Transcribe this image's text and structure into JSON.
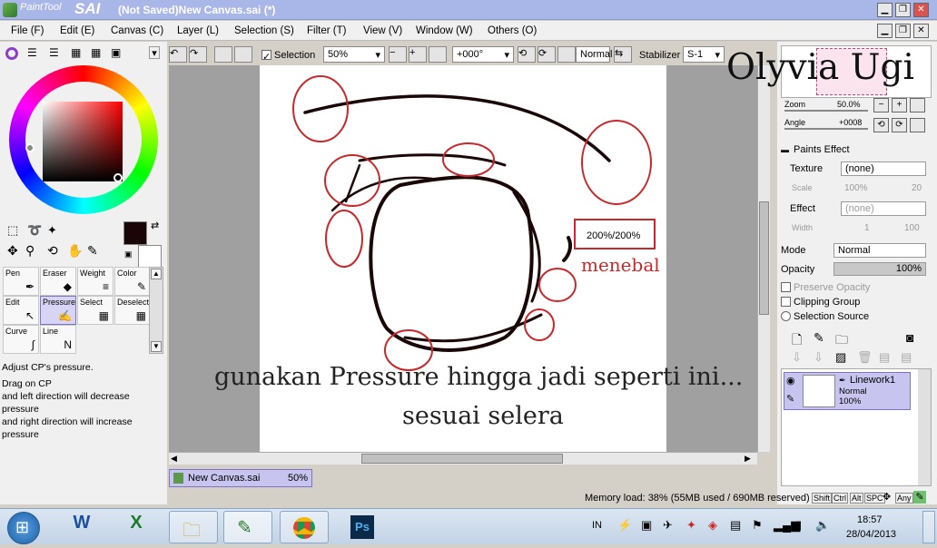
{
  "window": {
    "app": "PaintTool",
    "app_sub": "SAI",
    "title": "(Not Saved)New Canvas.sai (*)"
  },
  "menu": [
    "File (F)",
    "Edit (E)",
    "Canvas (C)",
    "Layer (L)",
    "Selection (S)",
    "Filter (T)",
    "View (V)",
    "Window (W)",
    "Others (O)"
  ],
  "toolbar": {
    "selection_label": "Selection",
    "zoom": "50%",
    "angle": "+000°",
    "blend": "Normal",
    "stabilizer_label": "Stabilizer",
    "stabilizer_value": "S-1"
  },
  "tools": [
    {
      "name": "Pen"
    },
    {
      "name": "Eraser"
    },
    {
      "name": "Weight"
    },
    {
      "name": "Color"
    },
    {
      "name": "Edit"
    },
    {
      "name": "Pressure"
    },
    {
      "name": "Select"
    },
    {
      "name": "Deselect"
    },
    {
      "name": "Curve"
    },
    {
      "name": "Line"
    }
  ],
  "help": {
    "title": "Adjust CP's pressure.",
    "lines": [
      "Drag on CP",
      "and left direction will decrease pressure",
      "and right direction will increase pressure"
    ]
  },
  "navigator": {
    "zoom_label": "Zoom",
    "zoom_value": "50.0%",
    "angle_label": "Angle",
    "angle_value": "+0008",
    "watermark": "Olyvia Ugi"
  },
  "paints": {
    "header": "Paints Effect",
    "texture_label": "Texture",
    "texture_value": "(none)",
    "scale_label": "Scale",
    "scale_value": "100%",
    "scale_num": "20",
    "effect_label": "Effect",
    "effect_value": "(none)",
    "width_label": "Width",
    "width_value": "1",
    "width_num": "100"
  },
  "layer": {
    "mode_label": "Mode",
    "mode_value": "Normal",
    "opacity_label": "Opacity",
    "opacity_value": "100%",
    "preserve": "Preserve Opacity",
    "clipping": "Clipping Group",
    "selection_source": "Selection Source",
    "layer_name": "Linework1",
    "layer_mode": "Normal",
    "layer_opacity": "100%"
  },
  "canvas_annotations": {
    "pressure_box": "200%/200%",
    "menebal": "menebal",
    "caption1": "gunakan Pressure hingga jadi seperti ini...",
    "caption2": "sesuai selera"
  },
  "doc_tab": {
    "name": "New Canvas.sai",
    "zoom": "50%"
  },
  "status": {
    "memory": "Memory load: 38% (55MB used / 690MB reserved)",
    "keys": [
      "Shift",
      "Ctrl",
      "Alt",
      "SPC",
      "Any"
    ]
  },
  "taskbar": {
    "lang": "IN",
    "time": "18:57",
    "date": "28/04/2013"
  },
  "colors": {
    "titlebar": "#a9b6e8",
    "accent_red": "#c8282a",
    "primary_color": "#1a0606"
  }
}
